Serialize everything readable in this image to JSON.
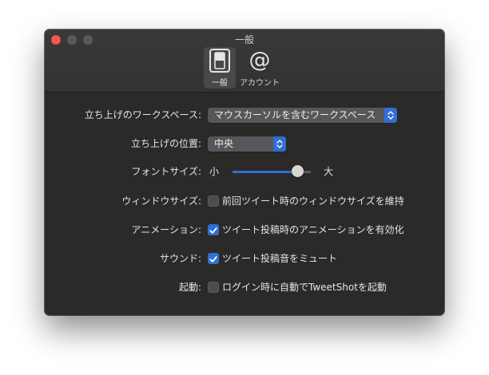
{
  "window": {
    "title": "一般",
    "toolbar": {
      "general": {
        "label": "一般",
        "icon": "switch-icon"
      },
      "account": {
        "label": "アカウント",
        "icon": "at-sign-icon",
        "glyph": "@"
      }
    }
  },
  "settings": {
    "launch_workspace": {
      "label": "立ち上げのワークスペース:",
      "value": "マウスカーソルを含むワークスペース"
    },
    "launch_position": {
      "label": "立ち上げの位置:",
      "value": "中央"
    },
    "font_size": {
      "label": "フォントサイズ:",
      "min_label": "小",
      "max_label": "大",
      "value": 0.83
    },
    "window_size": {
      "label": "ウィンドウサイズ:",
      "checkbox_label": "前回ツイート時のウィンドウサイズを維持",
      "checked": false
    },
    "animation": {
      "label": "アニメーション:",
      "checkbox_label": "ツイート投稿時のアニメーションを有効化",
      "checked": true
    },
    "sound": {
      "label": "サウンド:",
      "checkbox_label": "ツイート投稿音をミュート",
      "checked": true
    },
    "startup": {
      "label": "起動:",
      "checkbox_label": "ログイン時に自動でTweetShotを起動",
      "checked": false
    }
  },
  "colors": {
    "accent": "#2f6fd6",
    "close_button": "#ed5b55",
    "window_background": "#2c2a29"
  }
}
